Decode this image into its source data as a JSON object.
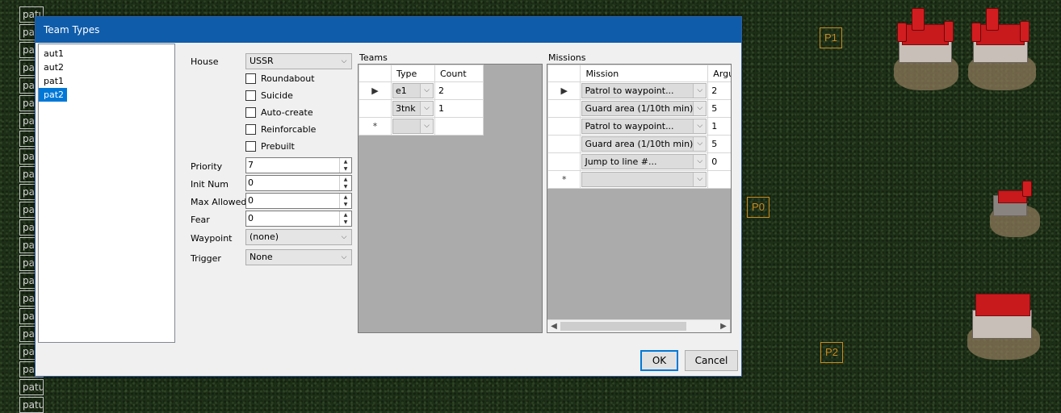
{
  "map": {
    "strip_labels": [
      "patu",
      "patu",
      "patu",
      "patu",
      "patu",
      "patu",
      "patu",
      "patu",
      "patu",
      "patu",
      "patu",
      "patu",
      "patu",
      "patu",
      "patu",
      "patu",
      "patu",
      "patu",
      "patu",
      "patu",
      "patu",
      "patu",
      "patu",
      "patu",
      "patu"
    ],
    "waypoints": [
      "P1",
      "P0",
      "P2"
    ]
  },
  "dialog": {
    "title": "Team Types",
    "team_list": [
      "aut1",
      "aut2",
      "pat1",
      "pat2"
    ],
    "selected_team": "pat2",
    "house": {
      "label": "House",
      "value": "USSR"
    },
    "checkboxes": [
      {
        "label": "Roundabout",
        "checked": false
      },
      {
        "label": "Suicide",
        "checked": false
      },
      {
        "label": "Auto-create",
        "checked": false
      },
      {
        "label": "Reinforcable",
        "checked": false
      },
      {
        "label": "Prebuilt",
        "checked": false
      }
    ],
    "priority": {
      "label": "Priority",
      "value": "7"
    },
    "init_num": {
      "label": "Init Num",
      "value": "0"
    },
    "max_allowed": {
      "label": "Max Allowed",
      "value": "0"
    },
    "fear": {
      "label": "Fear",
      "value": "0"
    },
    "waypoint": {
      "label": "Waypoint",
      "value": "(none)"
    },
    "trigger": {
      "label": "Trigger",
      "value": "None"
    },
    "teams": {
      "label": "Teams",
      "columns": [
        "Type",
        "Count"
      ],
      "rows": [
        {
          "marker": "▶",
          "type": "e1",
          "count": "2"
        },
        {
          "marker": "",
          "type": "3tnk",
          "count": "1"
        },
        {
          "marker": "*",
          "type": "",
          "count": ""
        }
      ]
    },
    "missions": {
      "label": "Missions",
      "columns": [
        "Mission",
        "Argu"
      ],
      "rows": [
        {
          "marker": "▶",
          "mission": "Patrol to waypoint...",
          "arg": "2"
        },
        {
          "marker": "",
          "mission": "Guard area (1/10th min)...",
          "arg": "5"
        },
        {
          "marker": "",
          "mission": "Patrol to waypoint...",
          "arg": "1"
        },
        {
          "marker": "",
          "mission": "Guard area (1/10th min)...",
          "arg": "5"
        },
        {
          "marker": "",
          "mission": "Jump to line #...",
          "arg": "0"
        },
        {
          "marker": "*",
          "mission": "",
          "arg": ""
        }
      ]
    },
    "ok_label": "OK",
    "cancel_label": "Cancel"
  }
}
